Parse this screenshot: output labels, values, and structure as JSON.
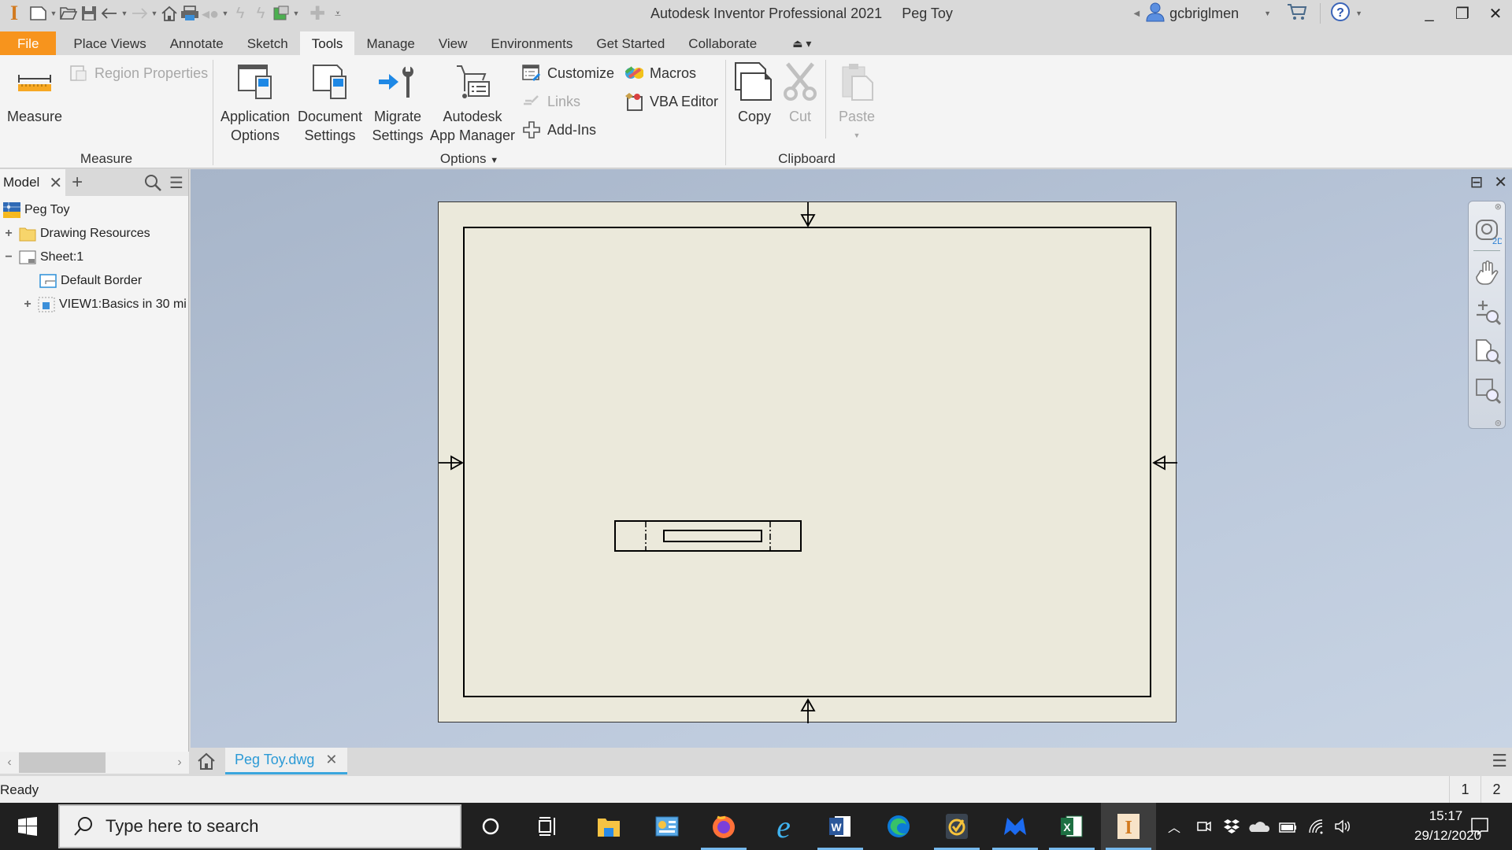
{
  "titlebar": {
    "app_name": "Autodesk Inventor Professional 2021",
    "document_name": "Peg Toy",
    "user": "gcbriglmen",
    "quick_access": [
      "new-icon",
      "open-icon",
      "save-icon",
      "undo-icon",
      "redo-icon",
      "home-icon",
      "print-icon",
      "return-icon",
      "update-icon",
      "update-all-icon",
      "appearance-icon",
      "add-icon",
      "customize-toolbar-icon"
    ]
  },
  "ribbon_tabs": [
    {
      "label": "File"
    },
    {
      "label": "Place Views"
    },
    {
      "label": "Annotate"
    },
    {
      "label": "Sketch"
    },
    {
      "label": "Tools",
      "active": true
    },
    {
      "label": "Manage"
    },
    {
      "label": "View"
    },
    {
      "label": "Environments"
    },
    {
      "label": "Get Started"
    },
    {
      "label": "Collaborate"
    }
  ],
  "ribbon": {
    "measure_panel": {
      "title": "Measure",
      "measure": "Measure",
      "region_properties": "Region Properties"
    },
    "options_panel": {
      "title": "Options",
      "application_options": [
        "Application",
        "Options"
      ],
      "document_settings": [
        "Document",
        "Settings"
      ],
      "migrate_settings": [
        "Migrate",
        "Settings"
      ],
      "app_manager": [
        "Autodesk",
        "App Manager"
      ],
      "customize": "Customize",
      "links": "Links",
      "add_ins": "Add-Ins",
      "macros": "Macros",
      "vba_editor": "VBA Editor"
    },
    "clipboard_panel": {
      "title": "Clipboard",
      "copy": "Copy",
      "cut": "Cut",
      "paste": "Paste"
    }
  },
  "browser": {
    "tab": "Model",
    "tree": [
      {
        "label": "Peg Toy",
        "level": 0
      },
      {
        "label": "Drawing Resources",
        "level": 1,
        "expander": "+"
      },
      {
        "label": "Sheet:1",
        "level": 1,
        "expander": "−"
      },
      {
        "label": "Default Border",
        "level": 2
      },
      {
        "label": "VIEW1:Basics in 30 mi",
        "level": 2,
        "expander": "+"
      }
    ]
  },
  "document_tabs": [
    {
      "label": "Peg Toy.dwg",
      "active": true
    }
  ],
  "status": {
    "text": "Ready",
    "numbers": [
      "1",
      "2"
    ]
  },
  "taskbar": {
    "search_placeholder": "Type here to search",
    "time": "15:17",
    "date": "29/12/2020",
    "apps": [
      "cortana",
      "task-view",
      "file-explorer",
      "control-panel",
      "firefox",
      "internet-explorer",
      "word",
      "edge",
      "norton",
      "malwarebytes",
      "excel",
      "inventor"
    ]
  },
  "colors": {
    "file_tab": "#f7941d",
    "doc_tab_accent": "#3aa6dd",
    "sheet": "#ebe9db",
    "canvas": "#b5c2d6"
  }
}
